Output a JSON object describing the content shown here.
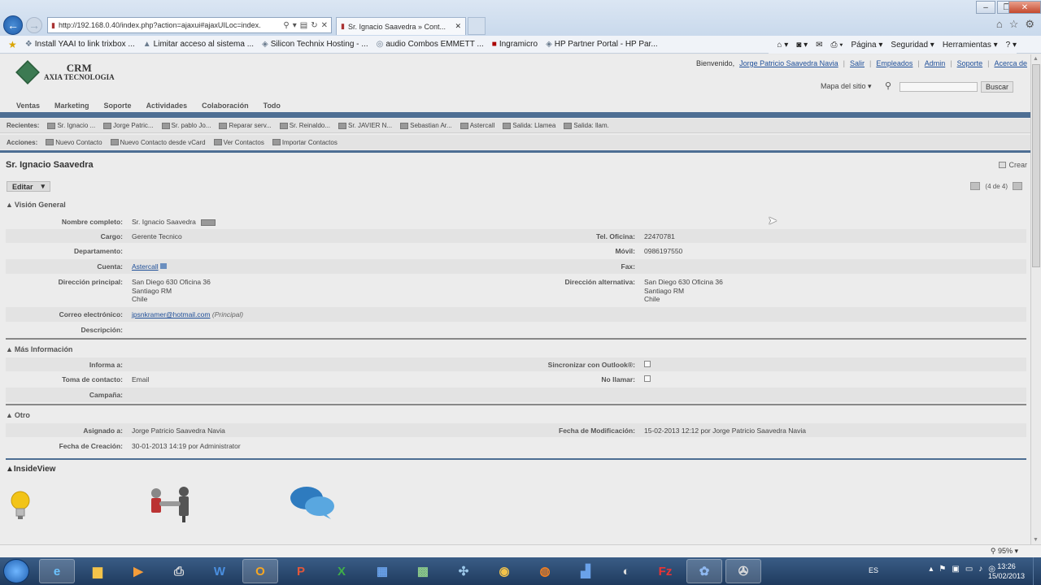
{
  "browser": {
    "url": "http://192.168.0.40/index.php?action=ajaxui#ajaxUILoc=index.",
    "tab_title": "Sr. Ignacio Saavedra » Cont...",
    "favorites": [
      "Install YAAI to link trixbox ...",
      "Limitar acceso al sistema ...",
      "Silicon Technix Hosting - ...",
      "audio Combos  EMMETT ...",
      "Ingramicro",
      "HP Partner Portal - HP Par..."
    ],
    "commands": [
      "Página ▾",
      "Seguridad ▾",
      "Herramientas ▾"
    ],
    "zoom": "95%"
  },
  "crm": {
    "logo_top": "CRM",
    "logo_bottom": "AXIA TECNOLOGIA",
    "welcome": "Bienvenido,",
    "user": "Jorge Patricio Saavedra Navia",
    "logout": "Salir",
    "links": [
      "Empleados",
      "Admin",
      "Soporte",
      "Acerca de"
    ],
    "sitemap": "Mapa del sitio ▾",
    "search_button": "Buscar",
    "nav": [
      "Ventas",
      "Marketing",
      "Soporte",
      "Actividades",
      "Colaboración",
      "Todo"
    ],
    "recent_label": "Recientes:",
    "recent": [
      "Sr. Ignacio ...",
      "Jorge Patric...",
      "Sr. pablo Jo...",
      "Reparar serv...",
      "Sr. Reinaldo...",
      "Sr. JAVIER N...",
      "Sebastian Ar...",
      "Astercall",
      "Salida: Llamea",
      "Salida: llam."
    ],
    "actions_label": "Acciones:",
    "actions": [
      "Nuevo Contacto",
      "Nuevo Contacto desde vCard",
      "Ver Contactos",
      "Importar Contactos"
    ]
  },
  "record": {
    "title": "Sr. Ignacio Saavedra",
    "create": "Crear",
    "edit": "Editar",
    "pager": "(4 de 4)",
    "sections": {
      "overview": "Visión General",
      "more": "Más Información",
      "other": "Otro",
      "insideview": "InsideView"
    },
    "fields": {
      "full_name_label": "Nombre completo:",
      "full_name": "Sr. Ignacio Saavedra",
      "title_label": "Cargo:",
      "title_value": "Gerente Tecnico",
      "office_phone_label": "Tel. Oficina:",
      "office_phone": "22470781",
      "department_label": "Departamento:",
      "mobile_label": "Móvil:",
      "mobile": "0986197550",
      "account_label": "Cuenta:",
      "account": "Astercall",
      "fax_label": "Fax:",
      "primary_address_label": "Dirección principal:",
      "primary_address": [
        "San Diego 630 Oficina 36",
        "Santiago RM",
        "Chile"
      ],
      "alt_address_label": "Dirección alternativa:",
      "alt_address": [
        "San Diego 630 Oficina 36",
        "Santiago RM",
        "Chile"
      ],
      "email_label": "Correo electrónico:",
      "email": "jpsnkramer@hotmail.com",
      "email_tag": "(Principal)",
      "description_label": "Descripción:",
      "reports_to_label": "Informa a:",
      "sync_label": "Sincronizar con Outlook®:",
      "lead_source_label": "Toma de contacto:",
      "lead_source": "Email",
      "do_not_call_label": "No llamar:",
      "campaign_label": "Campaña:",
      "assigned_label": "Asignado a:",
      "assigned": "Jorge Patricio Saavedra Navia",
      "modified_label": "Fecha de Modificación:",
      "modified": "15-02-2013 12:12 por Jorge Patricio Saavedra Navia",
      "created_label": "Fecha de Creación:",
      "created": "30-01-2013 14:19 por Administrator"
    }
  },
  "taskbar": {
    "lang": "ES",
    "time": "13:26",
    "date": "15/02/2013"
  }
}
